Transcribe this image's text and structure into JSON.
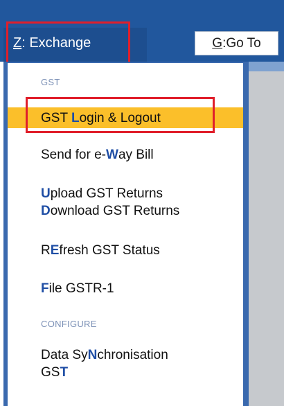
{
  "toolbar": {
    "exchange_key": "Z",
    "exchange_sep": ":",
    "exchange_label": " Exchange",
    "goto_key": "G",
    "goto_sep": ":",
    "goto_label": " Go To"
  },
  "menu": {
    "sections": [
      {
        "header": "GST"
      },
      {
        "header": "CONFIGURE"
      }
    ],
    "items": [
      {
        "pre": "GST ",
        "acc": "L",
        "post": "ogin & Logout"
      },
      {
        "pre": "Send for e-",
        "acc": "W",
        "post": "ay Bill"
      },
      {
        "pre": "",
        "acc": "U",
        "post": "pload GST Returns"
      },
      {
        "pre": "",
        "acc": "D",
        "post": "ownload GST Returns"
      },
      {
        "pre": "R",
        "acc": "E",
        "post": "fresh GST Status"
      },
      {
        "pre": "",
        "acc": "F",
        "post": "ile GSTR-1"
      },
      {
        "pre": "Data Sy",
        "acc": "N",
        "post": "chronisation"
      },
      {
        "pre": "GS",
        "acc": "T",
        "post": ""
      }
    ]
  },
  "colors": {
    "topbar": "#21579d",
    "menu_border": "#3a69ae",
    "highlight_row": "#fbbf2a",
    "accelerator": "#1f4ea5",
    "annotation_box": "#e01f2b"
  }
}
